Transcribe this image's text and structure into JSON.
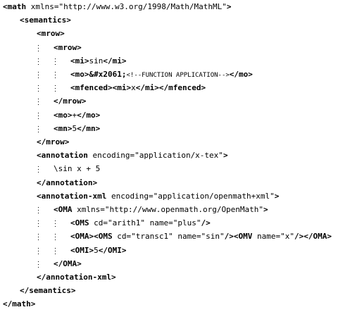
{
  "source": {
    "lines": [
      {
        "indent": 0,
        "segments": [
          {
            "t": "tag",
            "v": "<math "
          },
          {
            "t": "attr",
            "v": "xmlns="
          },
          {
            "t": "val",
            "v": "\"http://www.w3.org/1998/Math/MathML\""
          },
          {
            "t": "tag",
            "v": ">"
          }
        ]
      },
      {
        "indent": 1,
        "segments": [
          {
            "t": "tag",
            "v": "<semantics>"
          }
        ]
      },
      {
        "indent": 2,
        "segments": [
          {
            "t": "tag",
            "v": "<mrow>"
          }
        ]
      },
      {
        "indent": 3,
        "segments": [
          {
            "t": "tag",
            "v": "<mrow>"
          }
        ]
      },
      {
        "indent": 4,
        "segments": [
          {
            "t": "tag",
            "v": "<mi>"
          },
          {
            "t": "text",
            "v": "sin"
          },
          {
            "t": "tag",
            "v": "</mi>"
          }
        ]
      },
      {
        "indent": 4,
        "segments": [
          {
            "t": "tag",
            "v": "<mo>"
          },
          {
            "t": "tag",
            "v": "&#x2061;"
          },
          {
            "t": "comment",
            "v": "<!--FUNCTION APPLICATION-->"
          },
          {
            "t": "tag",
            "v": "</mo>"
          }
        ]
      },
      {
        "indent": 4,
        "segments": [
          {
            "t": "tag",
            "v": "<mfenced>"
          },
          {
            "t": "tag",
            "v": "<mi>"
          },
          {
            "t": "text",
            "v": "x"
          },
          {
            "t": "tag",
            "v": "</mi>"
          },
          {
            "t": "tag",
            "v": "</mfenced>"
          }
        ]
      },
      {
        "indent": 3,
        "segments": [
          {
            "t": "tag",
            "v": "</mrow>"
          }
        ]
      },
      {
        "indent": 3,
        "segments": [
          {
            "t": "tag",
            "v": "<mo>"
          },
          {
            "t": "text",
            "v": "+"
          },
          {
            "t": "tag",
            "v": "</mo>"
          }
        ]
      },
      {
        "indent": 3,
        "segments": [
          {
            "t": "tag",
            "v": "<mn>"
          },
          {
            "t": "text",
            "v": "5"
          },
          {
            "t": "tag",
            "v": "</mn>"
          }
        ]
      },
      {
        "indent": 2,
        "segments": [
          {
            "t": "tag",
            "v": "</mrow>"
          }
        ]
      },
      {
        "indent": 2,
        "segments": [
          {
            "t": "tag",
            "v": "<annotation "
          },
          {
            "t": "attr",
            "v": "encoding="
          },
          {
            "t": "val",
            "v": "\"application/x-tex\""
          },
          {
            "t": "tag",
            "v": ">"
          }
        ]
      },
      {
        "indent": 3,
        "segments": [
          {
            "t": "text",
            "v": "\\sin x + 5"
          }
        ]
      },
      {
        "indent": 2,
        "segments": [
          {
            "t": "tag",
            "v": "</annotation>"
          }
        ]
      },
      {
        "indent": 2,
        "segments": [
          {
            "t": "tag",
            "v": "<annotation-xml "
          },
          {
            "t": "attr",
            "v": "encoding="
          },
          {
            "t": "val",
            "v": "\"application/openmath+xml\""
          },
          {
            "t": "tag",
            "v": ">"
          }
        ]
      },
      {
        "indent": 3,
        "segments": [
          {
            "t": "tag",
            "v": "<OMA "
          },
          {
            "t": "attr",
            "v": "xmlns="
          },
          {
            "t": "val",
            "v": "\"http://www.openmath.org/OpenMath\""
          },
          {
            "t": "tag",
            "v": ">"
          }
        ]
      },
      {
        "indent": 4,
        "segments": [
          {
            "t": "tag",
            "v": "<OMS "
          },
          {
            "t": "attr",
            "v": "cd="
          },
          {
            "t": "val",
            "v": "\"arith1\" "
          },
          {
            "t": "attr",
            "v": "name="
          },
          {
            "t": "val",
            "v": "\"plus\""
          },
          {
            "t": "tag",
            "v": "/>"
          }
        ]
      },
      {
        "indent": 4,
        "segments": [
          {
            "t": "tag",
            "v": "<OMA>"
          },
          {
            "t": "tag",
            "v": "<OMS "
          },
          {
            "t": "attr",
            "v": "cd="
          },
          {
            "t": "val",
            "v": "\"transc1\" "
          },
          {
            "t": "attr",
            "v": "name="
          },
          {
            "t": "val",
            "v": "\"sin\""
          },
          {
            "t": "tag",
            "v": "/>"
          },
          {
            "t": "tag",
            "v": "<OMV "
          },
          {
            "t": "attr",
            "v": "name="
          },
          {
            "t": "val",
            "v": "\"x\""
          },
          {
            "t": "tag",
            "v": "/>"
          },
          {
            "t": "tag",
            "v": "</OMA>"
          }
        ]
      },
      {
        "indent": 4,
        "segments": [
          {
            "t": "tag",
            "v": "<OMI>"
          },
          {
            "t": "text",
            "v": "5"
          },
          {
            "t": "tag",
            "v": "</OMI>"
          }
        ]
      },
      {
        "indent": 3,
        "segments": [
          {
            "t": "tag",
            "v": "</OMA>"
          }
        ]
      },
      {
        "indent": 2,
        "segments": [
          {
            "t": "tag",
            "v": "</annotation-xml>"
          }
        ]
      },
      {
        "indent": 1,
        "segments": [
          {
            "t": "tag",
            "v": "</semantics>"
          }
        ]
      },
      {
        "indent": 0,
        "segments": [
          {
            "t": "tag",
            "v": "</math>"
          }
        ]
      }
    ]
  }
}
